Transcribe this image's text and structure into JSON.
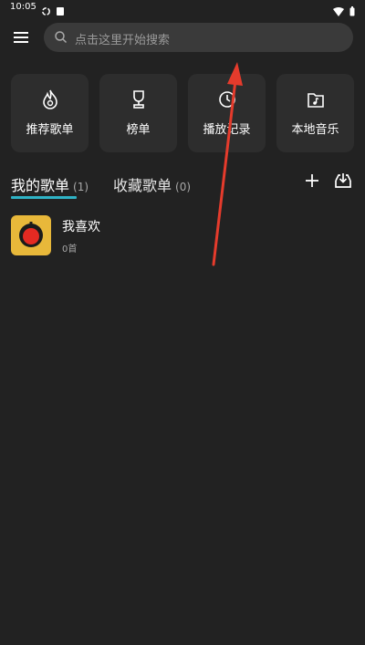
{
  "status_bar": {
    "time": "10:05"
  },
  "search": {
    "placeholder": "点击这里开始搜索"
  },
  "tiles": [
    {
      "label": "推荐歌单",
      "icon": "flame-icon"
    },
    {
      "label": "榜单",
      "icon": "trophy-icon"
    },
    {
      "label": "播放记录",
      "icon": "clock-icon"
    },
    {
      "label": "本地音乐",
      "icon": "music-folder-icon"
    }
  ],
  "tabs": {
    "my": {
      "label": "我的歌单",
      "count": "(1)"
    },
    "fav": {
      "label": "收藏歌单",
      "count": "(0)"
    }
  },
  "playlists": [
    {
      "name": "我喜欢",
      "count": "0首"
    }
  ],
  "colors": {
    "accent": "#2fb3c6",
    "background": "#222222",
    "tile": "#2d2d2d",
    "cover": "#e8b83a",
    "annotation_arrow": "#e53b2c"
  }
}
